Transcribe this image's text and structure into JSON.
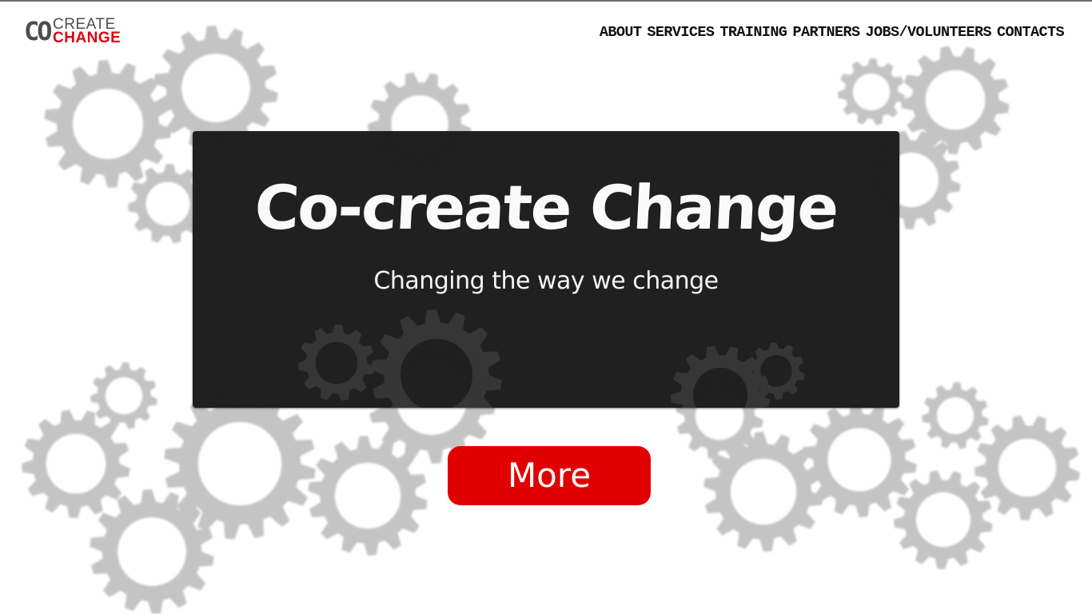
{
  "brand": {
    "logo_co": "CO",
    "logo_create": "CREATE",
    "logo_change": "CHANGE",
    "colors": {
      "accent": "#e00000",
      "dark": "#1c1c1c",
      "gear": "#c4c4c4"
    }
  },
  "nav": {
    "items": [
      "ABOUT",
      "SERVICES",
      "TRAINING",
      "PARTNERS",
      "JOBS/VOLUNTEERS",
      "CONTACTS"
    ]
  },
  "hero": {
    "title": "Co-create Change",
    "subtitle": "Changing the way we change"
  },
  "cta": {
    "label": "More"
  },
  "background": {
    "decoration": "gear-icon"
  }
}
